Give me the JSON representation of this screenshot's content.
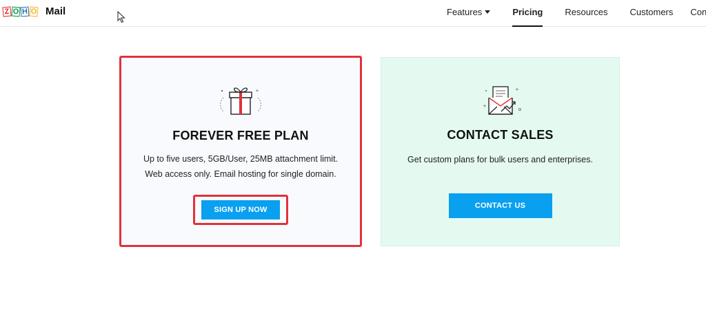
{
  "header": {
    "logo_letters": [
      "Z",
      "O",
      "H",
      "O"
    ],
    "brand": "Mail",
    "nav": [
      {
        "label": "Features",
        "has_caret": true,
        "active": false
      },
      {
        "label": "Pricing",
        "active": true
      },
      {
        "label": "Resources",
        "active": false
      },
      {
        "label": "Customers",
        "active": false
      },
      {
        "label": "Cont",
        "active": false
      }
    ]
  },
  "plans": {
    "free": {
      "icon": "gift-icon",
      "title": "FOREVER FREE PLAN",
      "desc_line1": "Up to five users, 5GB/User, 25MB attachment limit.",
      "desc_line2": "Web access only. Email hosting for single domain.",
      "button": "SIGN UP NOW"
    },
    "sales": {
      "icon": "envelope-icon",
      "title": "CONTACT SALES",
      "desc_line1": "Get custom plans for bulk users and enterprises.",
      "button": "CONTACT US"
    }
  },
  "colors": {
    "accent_button": "#0aa0f0",
    "highlight_border": "#e0323a",
    "sales_card_bg": "#e4faf0",
    "free_card_bg": "#f8fafd"
  }
}
